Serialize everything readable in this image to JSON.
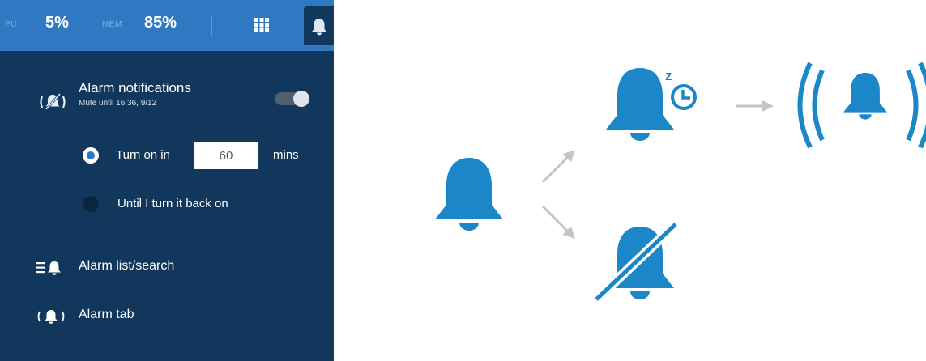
{
  "topbar": {
    "cpu_label": "PU",
    "cpu_value": "5%",
    "mem_label": "MEM",
    "mem_value": "85%",
    "apps_icon": "grid-icon",
    "bell_icon": "bell-icon"
  },
  "notifications": {
    "title": "Alarm notifications",
    "subtitle": "Mute until 16:36, 9/12",
    "toggle_on": false,
    "icon": "bell-muted-icon"
  },
  "mute_options": {
    "turn_on_label": "Turn on in",
    "minutes_value": "60",
    "minutes_unit": "mins",
    "until_label": "Until I turn it back on",
    "selected": "turn_on"
  },
  "menu": [
    {
      "label": "Alarm list/search",
      "icon": "alarm-list-icon"
    },
    {
      "label": "Alarm tab",
      "icon": "alarm-tab-icon"
    }
  ],
  "diagram": {
    "icons": [
      "bell-icon",
      "bell-snooze-clock-icon",
      "bell-ringing-icon",
      "bell-muted-icon"
    ],
    "snooze_letter": "z",
    "colors": {
      "accent": "#1b87c9",
      "arrow": "#c4c4c4",
      "panel": "#11385c",
      "topbar": "#2f79c2"
    }
  }
}
